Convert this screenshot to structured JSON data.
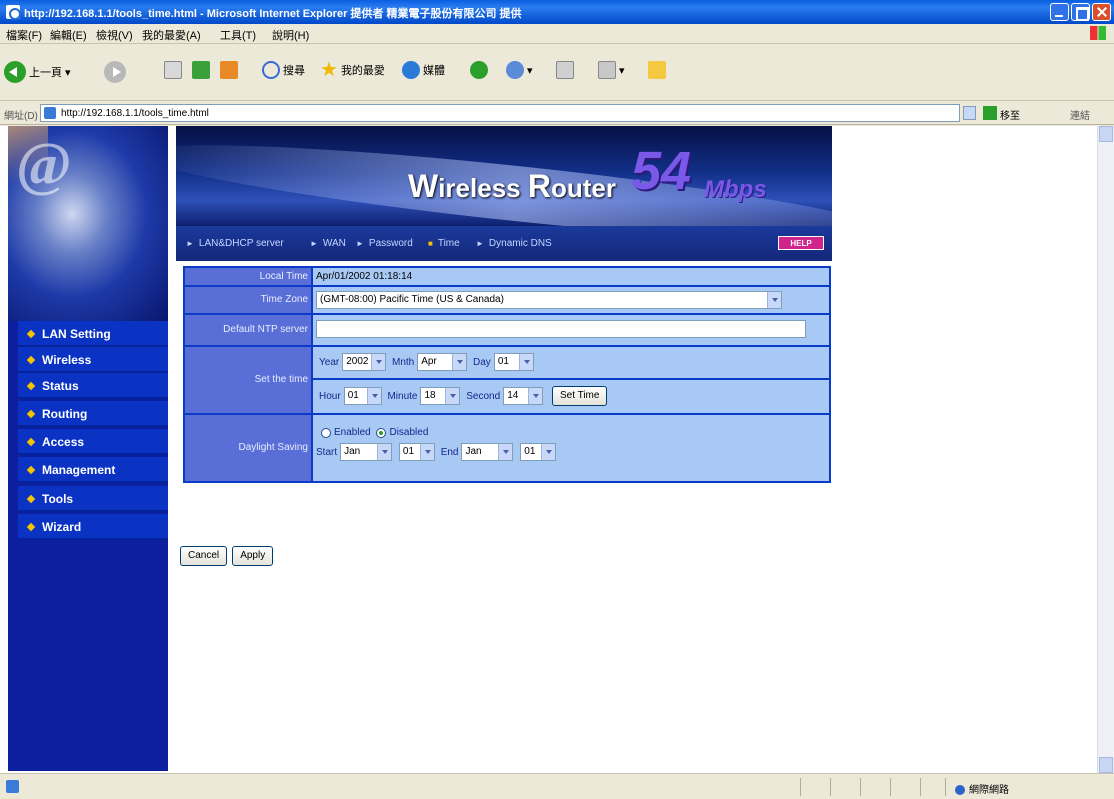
{
  "window": {
    "title": "http://192.168.1.1/tools_time.html - Microsoft Internet Explorer 提供者 精業電子股份有限公司 提供"
  },
  "menubar": [
    "檔案(F)",
    "編輯(E)",
    "檢視(V)",
    "我的最愛(A)",
    "工具(T)",
    "說明(H)"
  ],
  "toolbar": {
    "back_label": "上一頁",
    "search_label": "搜尋",
    "favorites_label": "我的最愛",
    "media_label": "媒體"
  },
  "address": {
    "label": "網址(D)",
    "url": "http://192.168.1.1/tools_time.html",
    "go_label": "移至",
    "links_label": "連結"
  },
  "banner": {
    "product_w": "W",
    "product_rest": "ireless ",
    "product_r": "R",
    "product_rest2": "outer",
    "speed": "54",
    "unit": "Mbps",
    "help_label": "HELP"
  },
  "subnav": [
    {
      "label": "LAN&DHCP server",
      "current": false
    },
    {
      "label": "WAN",
      "current": false
    },
    {
      "label": "Password",
      "current": false
    },
    {
      "label": "Time",
      "current": true
    },
    {
      "label": "Dynamic DNS",
      "current": false
    }
  ],
  "sidebar": [
    {
      "label": "LAN Setting",
      "active": true
    },
    {
      "label": "Wireless",
      "active": false
    },
    {
      "label": "Status",
      "active": false
    },
    {
      "label": "Routing",
      "active": false
    },
    {
      "label": "Access",
      "active": false
    },
    {
      "label": "Management",
      "active": false
    },
    {
      "label": "Tools",
      "active": false
    },
    {
      "label": "Wizard",
      "active": false
    }
  ],
  "form": {
    "local_time_label": "Local Time",
    "local_time_value": "Apr/01/2002 01:18:14",
    "time_zone_label": "Time Zone",
    "time_zone_value": "(GMT-08:00) Pacific Time (US & Canada)",
    "ntp_label": "Default NTP server",
    "ntp_value": "",
    "set_time_label": "Set the time",
    "year_label": "Year",
    "year_value": "2002",
    "month_label": "Mnth",
    "month_value": "Apr",
    "day_label": "Day",
    "day_value": "01",
    "hour_label": "Hour",
    "hour_value": "01",
    "minute_label": "Minute",
    "minute_value": "18",
    "second_label": "Second",
    "second_value": "14",
    "set_time_button": "Set Time",
    "daylight_label": "Daylight Saving",
    "enabled_label": "Enabled",
    "disabled_label": "Disabled",
    "daylight_selected": "Disabled",
    "start_label": "Start",
    "start_month": "Jan",
    "start_day": "01",
    "end_label": "End",
    "end_month": "Jan",
    "end_day": "01"
  },
  "buttons": {
    "cancel": "Cancel",
    "apply": "Apply"
  },
  "status": {
    "zone": "網際網路"
  }
}
